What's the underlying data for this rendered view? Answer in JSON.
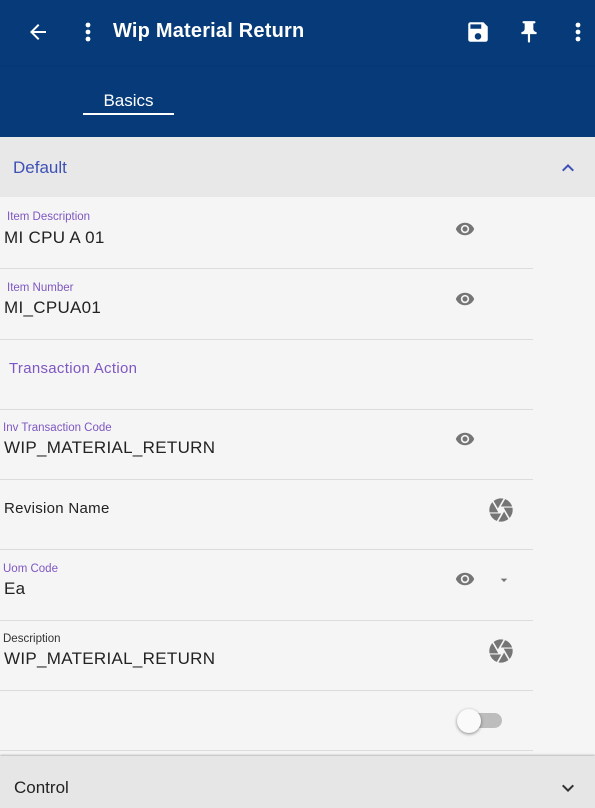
{
  "appbar": {
    "title": "Wip Material Return",
    "icons": [
      "back-arrow-icon",
      "more-vert-icon",
      "save-icon",
      "pin-icon",
      "more-vert-icon"
    ]
  },
  "tabs": [
    {
      "label": "Basics",
      "active": true
    }
  ],
  "section_default": {
    "label": "Default",
    "expanded": true
  },
  "fields": {
    "item_description": {
      "label": "Item Description",
      "value": "MI CPU A 01"
    },
    "item_number": {
      "label": "Item Number",
      "value": "MI_CPUA01"
    },
    "transaction_action": {
      "label": "Transaction Action"
    },
    "inv_transaction_code": {
      "label": "Inv Transaction Code",
      "value": "WIP_MATERIAL_RETURN"
    },
    "revision_name": {
      "label": "Revision Name"
    },
    "uom_code": {
      "label": "Uom Code",
      "value": "Ea"
    },
    "description": {
      "label": "Description",
      "value": "WIP_MATERIAL_RETURN"
    }
  },
  "toggle": {
    "on": false
  },
  "section_control": {
    "label": "Control",
    "expanded": false
  },
  "colors": {
    "primary": "#063a78",
    "accent_label": "#7e57c2",
    "section_label": "#3f51b5"
  }
}
